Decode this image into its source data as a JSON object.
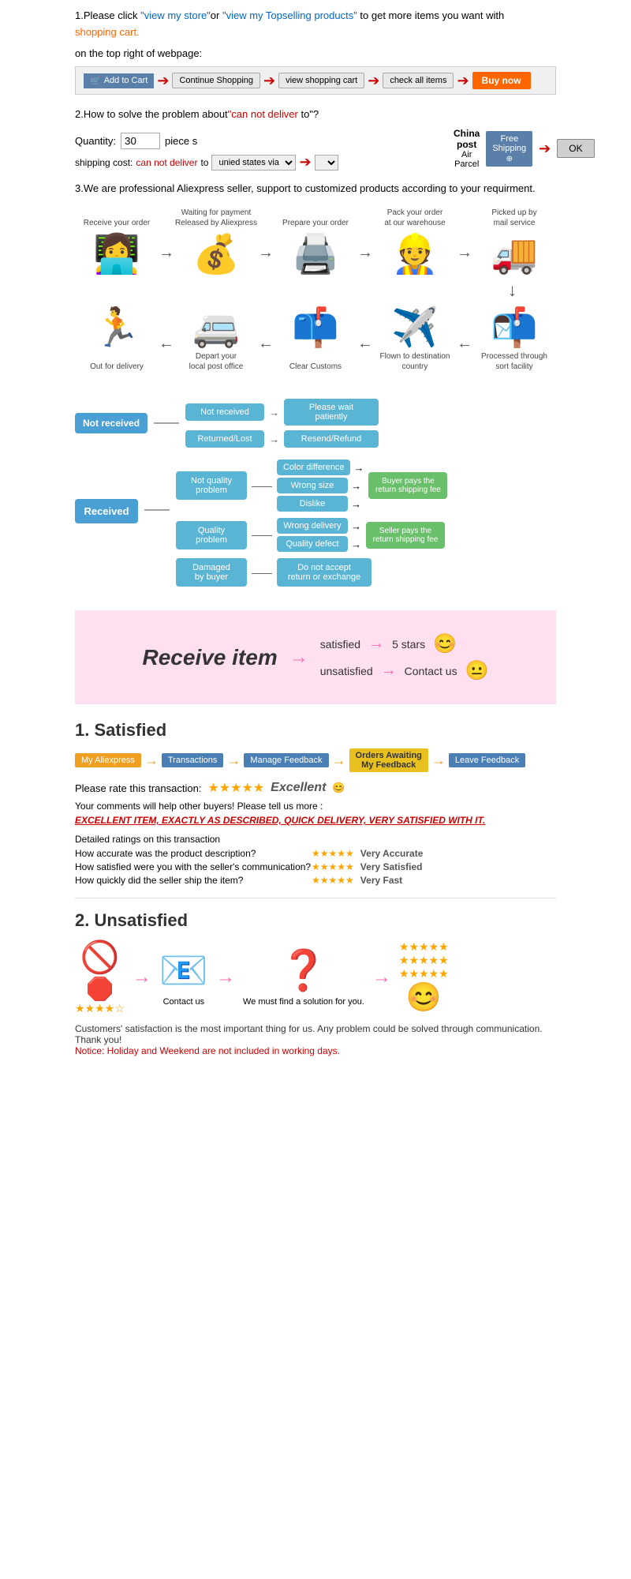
{
  "step1": {
    "text1": "1.Please click ",
    "link1": "\"view my store\"",
    "or": "or ",
    "link2": "\"view my Topselling products\"",
    "text2": " to get more items you want with",
    "text3": "shopping cart.",
    "text4": "on the top right of webpage:",
    "cart_btn": "Add to Cart",
    "continue_btn": "Continue Shopping",
    "view_btn": "view shopping cart",
    "check_btn": "check all items",
    "buy_btn": "Buy now"
  },
  "step2": {
    "label": "2.How to solve the problem about",
    "cant": "\"can not deliver",
    "to_text": " to\"?",
    "qty_label": "Quantity:",
    "qty_value": "30",
    "piece": "piece s",
    "shipping_label": "shipping cost:",
    "cant_deliver": "can not deliver",
    "to": " to ",
    "unied": "unied states via",
    "china_post": "China post",
    "air_parcel": "Air Parcel",
    "free_shipping": "Free\nShipping",
    "ok": "OK"
  },
  "step3": {
    "text": "3.We are professional Aliexpress seller, support to customized products according to your requirment."
  },
  "process": {
    "row1": [
      {
        "label": "Receive your order",
        "icon": "👩‍💻"
      },
      {
        "label": "Waiting for payment\nReleased by Aliexpress",
        "icon": "💰"
      },
      {
        "label": "Prepare your order",
        "icon": "📦"
      },
      {
        "label": "Pack your order\nat our warehouse",
        "icon": "👷"
      },
      {
        "label": "Picked up by\nmail service",
        "icon": "🚚"
      }
    ],
    "row2": [
      {
        "label": "Out for delivery",
        "icon": "🏃"
      },
      {
        "label": "Depart your\nlocal post office",
        "icon": "🚐"
      },
      {
        "label": "Clear Customs",
        "icon": "📫"
      },
      {
        "label": "Flown to destination\ncountry",
        "icon": "✈️"
      },
      {
        "label": "Processed through\nsort facility",
        "icon": "📬"
      }
    ]
  },
  "flowchart": {
    "not_received": "Not received",
    "nr_branch1": "Not received",
    "nr_branch1_result": "Please wait\npatiently",
    "nr_branch2": "Returned/Lost",
    "nr_branch2_result": "Resend/Refund",
    "received": "Received",
    "not_quality": "Not quality\nproblem",
    "quality": "Quality\nproblem",
    "damaged": "Damaged\nby buyer",
    "sub1": "Color difference",
    "sub2": "Wrong size",
    "sub3": "Dislike",
    "sub4": "Wrong delivery",
    "sub5": "Quality defect",
    "result_buyer": "Buyer pays the\nreturn shipping fee",
    "result_seller": "Seller pays the\nreturn shipping fee",
    "result_no_return": "Do not accept\nreturn or exchange"
  },
  "satisfaction": {
    "receive_item": "Receive item",
    "arrow": "→",
    "satisfied": "satisfied",
    "unsatisfied": "unsatisfied",
    "five_stars": "5 stars",
    "contact_us": "Contact us"
  },
  "satisfied_section": {
    "title": "1. Satisfied",
    "steps": [
      "My Aliexpress",
      "Transactions",
      "Manage Feedback",
      "Orders Awaiting\nMy Feedback",
      "Leave Feedback"
    ],
    "rate_label": "Please rate this transaction:",
    "rate_word": "Excellent",
    "comment_label": "Your comments will help other buyers! Please tell us more :",
    "excellent_item": "EXCELLENT ITEM, EXACTLY AS DESCRIBED, QUICK DELIVERY, VERY SATISFIED WITH IT.",
    "detail_label": "Detailed ratings on this transaction",
    "ratings": [
      {
        "label": "How accurate was the product description?",
        "desc": "Very Accurate"
      },
      {
        "label": "How satisfied were you with the seller's communication?",
        "desc": "Very Satisfied"
      },
      {
        "label": "How quickly did the seller ship the item?",
        "desc": "Very Fast"
      }
    ]
  },
  "unsatisfied_section": {
    "title": "2. Unsatisfied",
    "no_icon": "🚫",
    "stop_icon": "🛑",
    "email_icon": "📧",
    "question_icon": "❓",
    "smiley_icon": "😊",
    "contact_label": "Contact us",
    "find_solution": "We must find\na solution for\nyou.",
    "notice": "Customers' satisfaction is the most important thing for us. Any problem could be solved through communication. Thank you!",
    "notice_holiday": "Notice: Holiday and Weekend are not included in working days."
  }
}
